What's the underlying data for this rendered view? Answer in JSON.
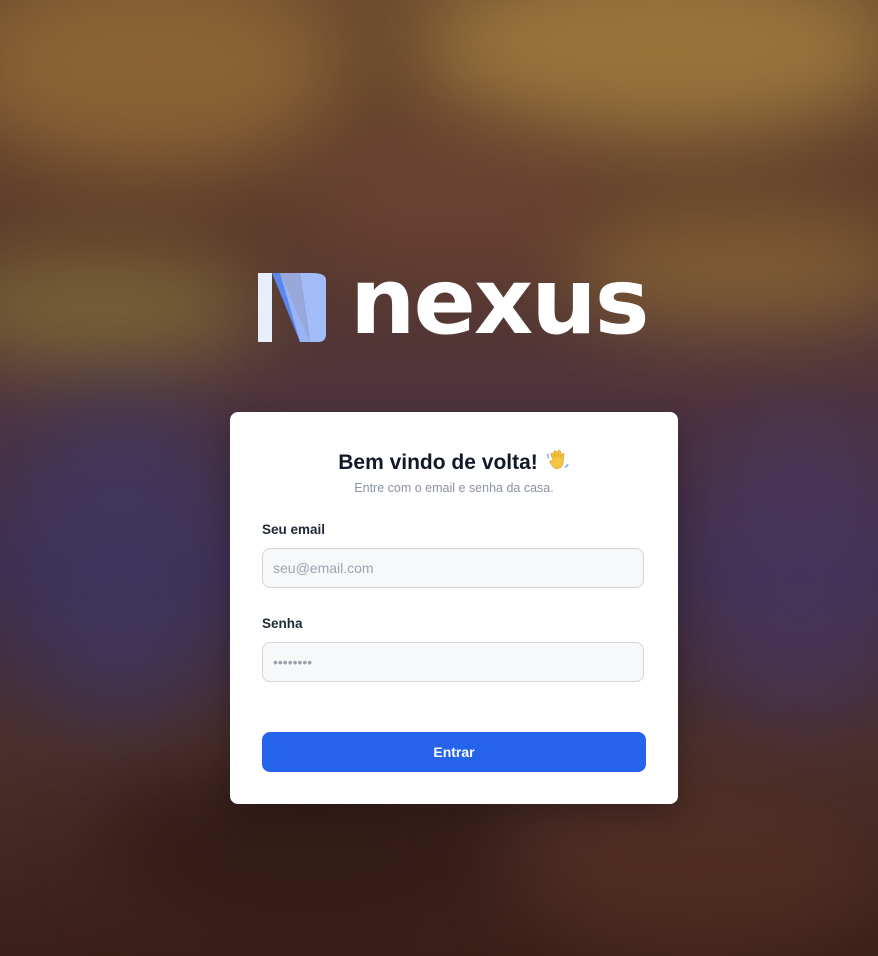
{
  "brand": {
    "name": "nexus",
    "logo_icon": "nexus-n-mark",
    "accent_light": "#e8eefc",
    "accent_mid": "#a3bcf7",
    "accent_dark": "#5b86ee"
  },
  "login": {
    "title": "Bem vindo de volta!",
    "title_emoji": "waving-hand-icon",
    "subtitle": "Entre com o email e senha da casa.",
    "email_label": "Seu email",
    "email_placeholder": "seu@email.com",
    "email_value": "",
    "password_label": "Senha",
    "password_placeholder": "••••••••",
    "password_value": "",
    "submit_label": "Entrar",
    "submit_color": "#2563eb"
  }
}
